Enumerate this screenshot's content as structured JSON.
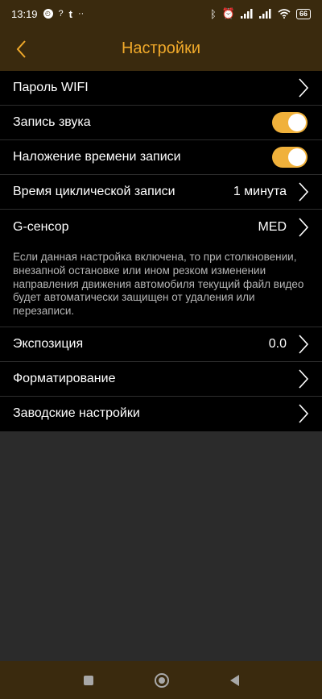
{
  "status_bar": {
    "time": "13:19",
    "left_icons": [
      "alarm-badge-icon",
      "wifi-question-icon",
      "t-icon",
      "dots-icon"
    ],
    "right_icons": [
      "bluetooth-icon",
      "alarm-icon",
      "signal-icon",
      "signal-icon",
      "wifi-icon",
      "battery-icon"
    ],
    "battery_level": "66"
  },
  "header": {
    "title": "Настройки",
    "back_icon": "chevron-left-icon",
    "accent_color": "#f0a92a"
  },
  "settings": {
    "wifi_password": {
      "label": "Пароль WIFI"
    },
    "sound_recording": {
      "label": "Запись звука",
      "enabled": true
    },
    "timestamp_overlay": {
      "label": "Наложение времени записи",
      "enabled": true
    },
    "loop_time": {
      "label": "Время циклической записи",
      "value": "1 минута"
    },
    "gsensor": {
      "label": "G-сенсор",
      "value": "MED",
      "description": "Если данная настройка включена, то при столкновении, внезапной остановке или ином резком изменении направления движения автомобиля текущий файл видео будет автоматически защищен от удаления или перезаписи."
    },
    "exposure": {
      "label": "Экспозиция",
      "value": "0.0"
    },
    "format": {
      "label": "Форматирование"
    },
    "factory_reset": {
      "label": "Заводские настройки"
    }
  },
  "colors": {
    "bar_bg": "#3a2a0e",
    "toggle_on": "#f0b13b",
    "list_bg": "#000000",
    "page_bg": "#2b2b2b"
  },
  "nav_bar": {
    "icons": [
      "recents-square-icon",
      "home-circle-icon",
      "back-triangle-icon"
    ]
  }
}
